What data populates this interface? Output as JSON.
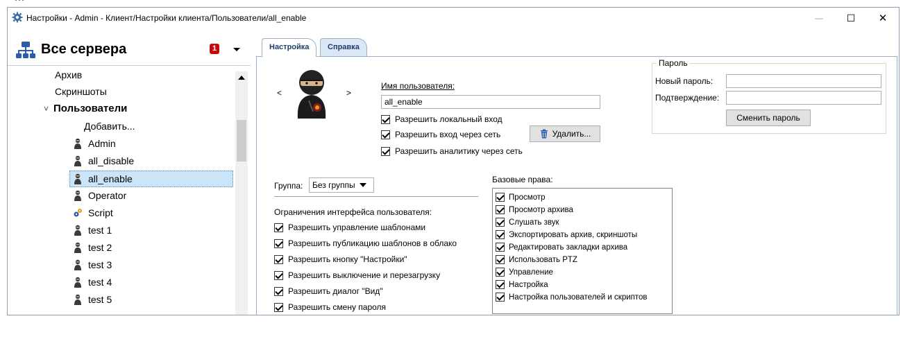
{
  "top_caption": "…",
  "window": {
    "title": "Настройки - Admin - Клиент/Настройки клиента/Пользователи/all_enable",
    "controls": {
      "minimize": "—",
      "maximize": "☐",
      "close": "✕"
    }
  },
  "server_selector": {
    "label": "Все сервера",
    "badge": "1"
  },
  "tree": {
    "items": [
      {
        "label": "Архив",
        "type": "node"
      },
      {
        "label": "Скриншоты",
        "type": "node"
      },
      {
        "label": "Пользователи",
        "type": "expanded-node",
        "chevron": "˅"
      },
      {
        "label": "Добавить...",
        "type": "action"
      },
      {
        "label": "Admin",
        "type": "user"
      },
      {
        "label": "all_disable",
        "type": "user"
      },
      {
        "label": "all_enable",
        "type": "user",
        "selected": true
      },
      {
        "label": "Operator",
        "type": "user"
      },
      {
        "label": "Script",
        "type": "script"
      },
      {
        "label": "test 1",
        "type": "user"
      },
      {
        "label": "test 2",
        "type": "user"
      },
      {
        "label": "test 3",
        "type": "user"
      },
      {
        "label": "test 4",
        "type": "user"
      },
      {
        "label": "test 5",
        "type": "user"
      }
    ]
  },
  "tabs": [
    {
      "label": "Настройка",
      "active": true
    },
    {
      "label": "Справка",
      "active": false
    }
  ],
  "avatar": {
    "prev": "<",
    "next": ">"
  },
  "user": {
    "name_label": "Имя пользователя:",
    "name_value": "all_enable",
    "checks": [
      {
        "label": "Разрешить локальный вход",
        "checked": true
      },
      {
        "label": "Разрешить вход через сеть",
        "checked": true
      },
      {
        "label": "Разрешить аналитику через сеть",
        "checked": true
      }
    ],
    "delete_button": "Удалить..."
  },
  "password": {
    "legend": "Пароль",
    "new_label": "Новый пароль:",
    "new_value": "",
    "confirm_label": "Подтверждение:",
    "confirm_value": "",
    "change_button": "Сменить пароль"
  },
  "group": {
    "label": "Группа:",
    "value": "Без группы"
  },
  "ui_limits": {
    "title": "Ограничения интерфейса пользователя:",
    "checks": [
      {
        "label": "Разрешить управление шаблонами",
        "checked": true
      },
      {
        "label": "Разрешить публикацию шаблонов в облако",
        "checked": true
      },
      {
        "label": "Разрешить кнопку \"Настройки\"",
        "checked": true
      },
      {
        "label": "Разрешить выключение и перезагрузку",
        "checked": true
      },
      {
        "label": "Разрешить диалог \"Вид\"",
        "checked": true
      },
      {
        "label": "Разрешить смену пароля",
        "checked": true
      }
    ]
  },
  "base_rights": {
    "title": "Базовые права:",
    "checks": [
      {
        "label": "Просмотр",
        "checked": true
      },
      {
        "label": "Просмотр архива",
        "checked": true
      },
      {
        "label": "Слушать звук",
        "checked": true
      },
      {
        "label": "Экспортировать архив, скриншоты",
        "checked": true
      },
      {
        "label": "Редактировать закладки архива",
        "checked": true
      },
      {
        "label": "Использовать PTZ",
        "checked": true
      },
      {
        "label": "Управление",
        "checked": true
      },
      {
        "label": "Настройка",
        "checked": true
      },
      {
        "label": "Настройка пользователей и скриптов",
        "checked": true
      }
    ]
  },
  "colors": {
    "tab_text": "#1e3e6c",
    "selection": "#cce4f7",
    "badge": "#c40b0b",
    "window_border": "#8aa0b8"
  }
}
